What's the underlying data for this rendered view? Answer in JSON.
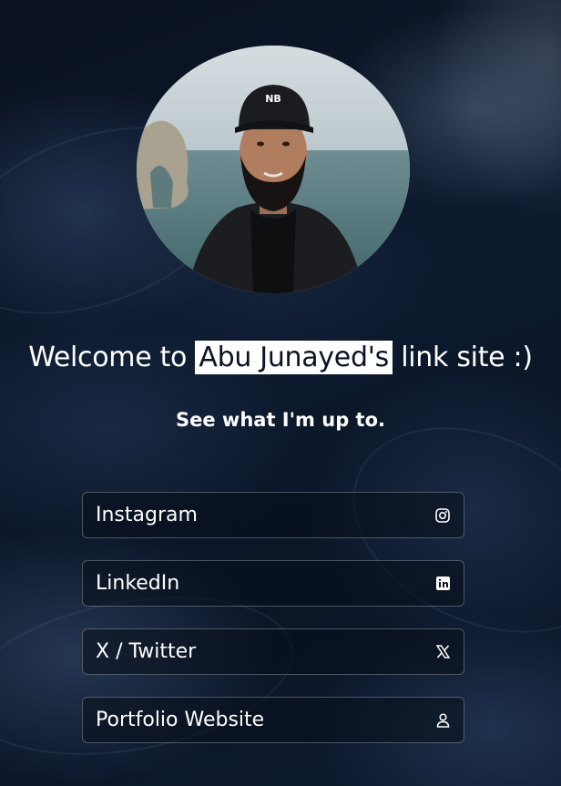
{
  "profile": {
    "avatar_alt": "Profile photo"
  },
  "headline": {
    "prefix": "Welcome to",
    "highlight": "Abu Junayed's",
    "suffix": "link site :)"
  },
  "subheadline": "See what I'm up to.",
  "links": [
    {
      "label": "Instagram",
      "icon": "instagram-icon"
    },
    {
      "label": "LinkedIn",
      "icon": "linkedin-icon"
    },
    {
      "label": "X / Twitter",
      "icon": "x-twitter-icon"
    },
    {
      "label": "Portfolio Website",
      "icon": "user-icon"
    }
  ],
  "colors": {
    "background": "#0b1424",
    "text": "#ffffff",
    "highlight_bg": "#ffffff"
  }
}
